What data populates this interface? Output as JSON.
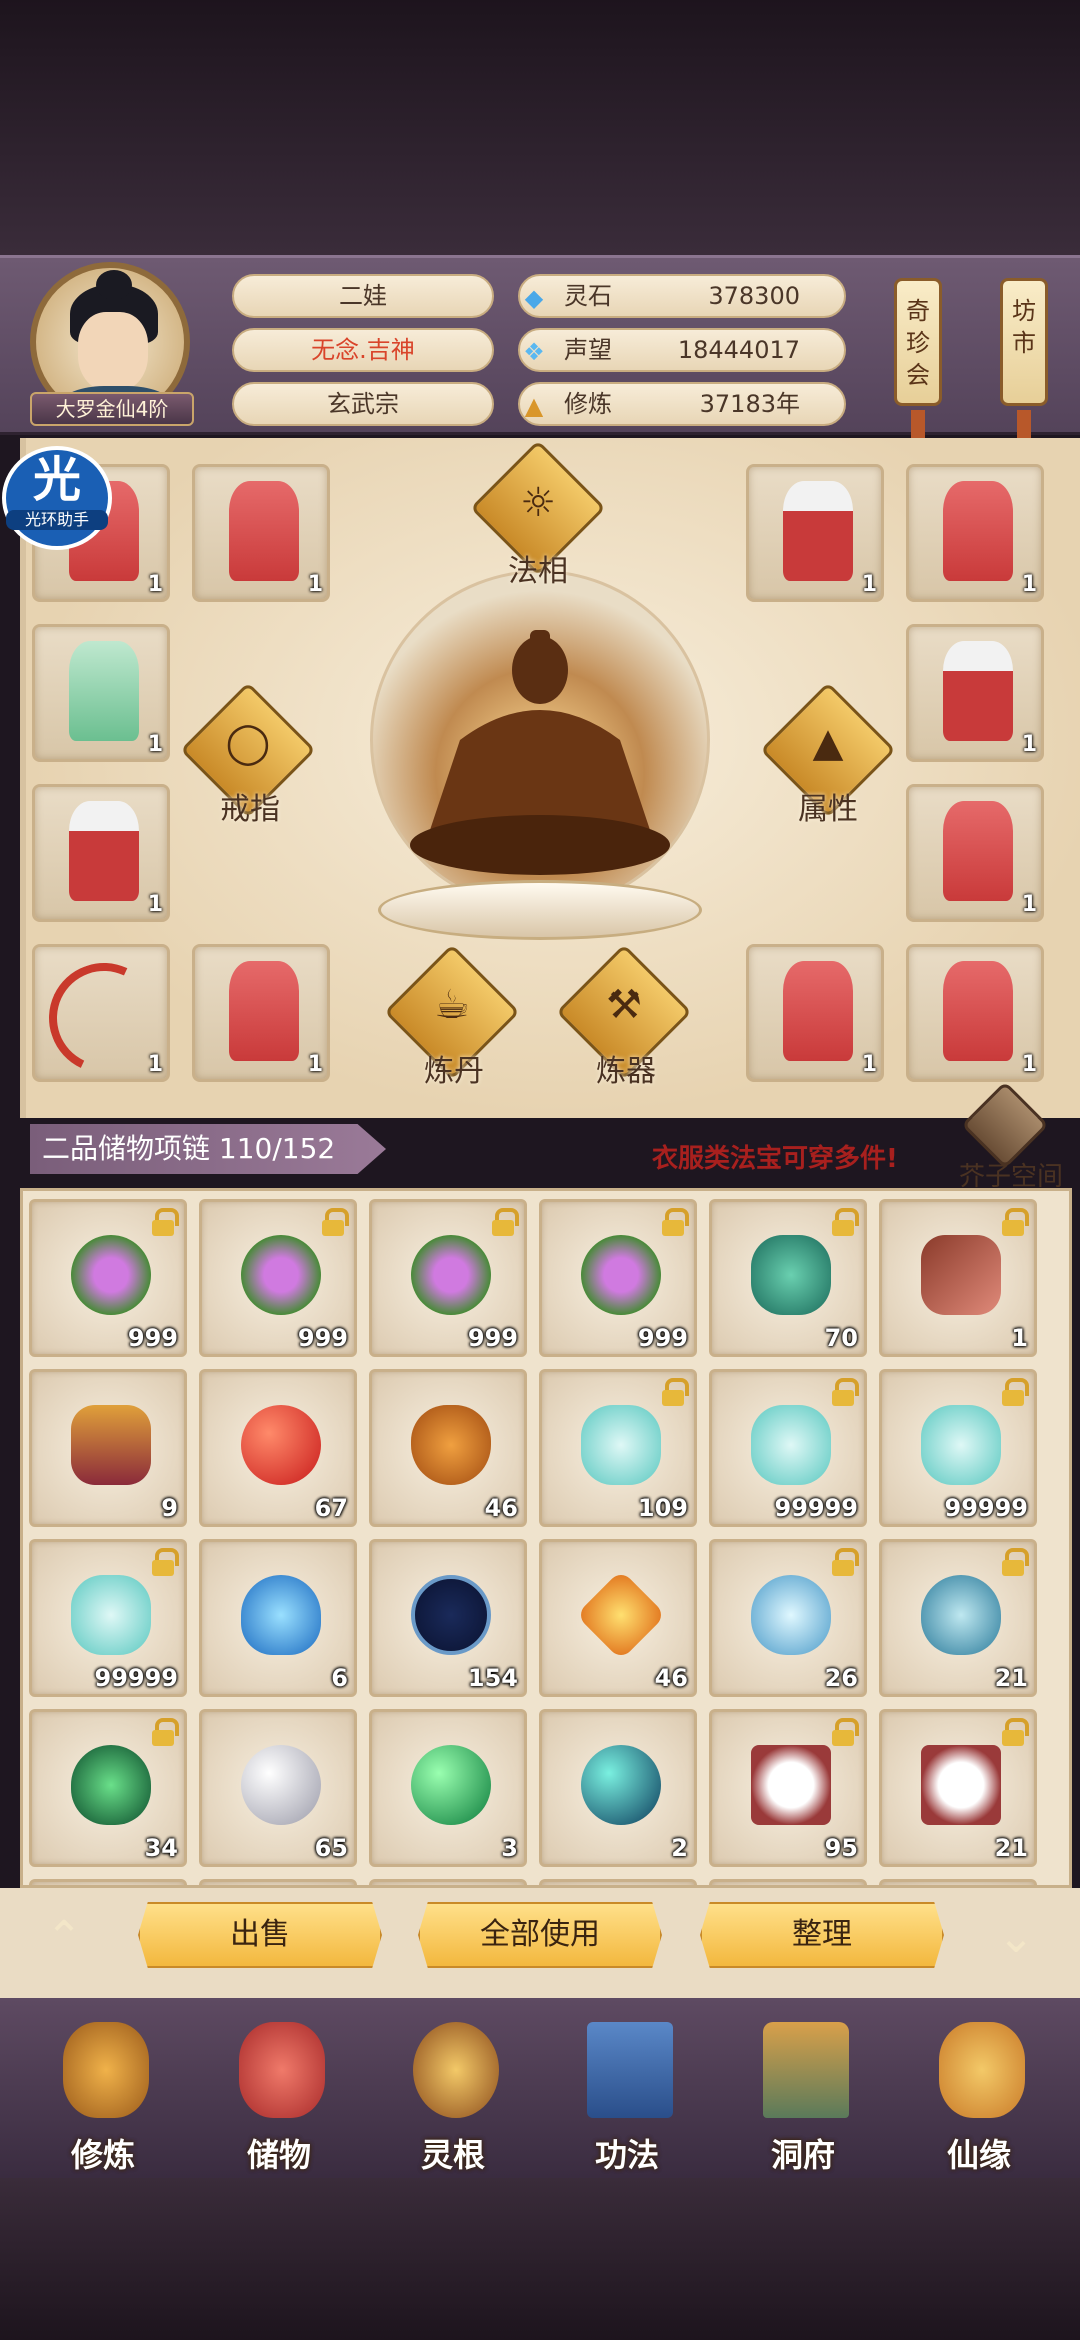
{
  "player": {
    "name": "二娃",
    "title": "无念.吉神",
    "sect": "玄武宗",
    "rank": "大罗金仙4阶"
  },
  "resources": [
    {
      "label": "灵石",
      "value": "378300",
      "icon": "crystal-icon",
      "color": "#4aa8e8"
    },
    {
      "label": "声望",
      "value": "18444017",
      "icon": "flame-icon",
      "color": "#5ab8f0"
    },
    {
      "label": "修炼",
      "value": "37183年",
      "icon": "meditation-icon",
      "color": "#d9962a"
    }
  ],
  "side_tags": [
    {
      "label": "奇珍会"
    },
    {
      "label": "坊市"
    }
  ],
  "overlay_badge": {
    "char": "光",
    "text": "光环助手"
  },
  "equipment": {
    "functions": [
      {
        "label": "法相",
        "icon": "meditation-icon"
      },
      {
        "label": "戒指",
        "icon": "ring-icon"
      },
      {
        "label": "属性",
        "icon": "hat-icon"
      },
      {
        "label": "炼丹",
        "icon": "cauldron-icon"
      },
      {
        "label": "炼器",
        "icon": "anvil-icon"
      }
    ],
    "slots": [
      {
        "item": "red-robe",
        "qty": "1"
      },
      {
        "item": "red-robe",
        "qty": "1"
      },
      {
        "item": "white-red-robe",
        "qty": "1"
      },
      {
        "item": "red-robe",
        "qty": "1"
      },
      {
        "item": "green-robe",
        "qty": "1"
      },
      {
        "item": "white-red-robe",
        "qty": "1"
      },
      {
        "item": "white-red-robe",
        "qty": "1"
      },
      {
        "item": "red-robe",
        "qty": "1"
      },
      {
        "item": "bow",
        "qty": "1"
      },
      {
        "item": "red-robe",
        "qty": "1"
      },
      {
        "item": "red-robe",
        "qty": "1"
      },
      {
        "item": "red-robe",
        "qty": "1"
      }
    ]
  },
  "storage": {
    "tab_label": "二品储物项链 110/152",
    "notice": "衣服类法宝可穿多件!",
    "space_label": "芥子空间",
    "items": [
      {
        "icon": "purple-herb",
        "qty": "999",
        "locked": true
      },
      {
        "icon": "purple-herb",
        "qty": "999",
        "locked": true
      },
      {
        "icon": "purple-herb",
        "qty": "999",
        "locked": true
      },
      {
        "icon": "purple-herb",
        "qty": "999",
        "locked": true
      },
      {
        "icon": "teal-plant",
        "qty": "70",
        "locked": true
      },
      {
        "icon": "red-branch",
        "qty": "1",
        "locked": true
      },
      {
        "icon": "scroll-drum",
        "qty": "9",
        "locked": false
      },
      {
        "icon": "red-orb",
        "qty": "67",
        "locked": false
      },
      {
        "icon": "gourd",
        "qty": "46",
        "locked": false
      },
      {
        "icon": "potion-bottle",
        "qty": "109",
        "locked": true
      },
      {
        "icon": "potion-bottle",
        "qty": "99999",
        "locked": true
      },
      {
        "icon": "potion-bottle",
        "qty": "99999",
        "locked": true
      },
      {
        "icon": "potion-bottle",
        "qty": "99999",
        "locked": true
      },
      {
        "icon": "spirit-bowl",
        "qty": "6",
        "locked": false
      },
      {
        "icon": "star-disc",
        "qty": "154",
        "locked": false
      },
      {
        "icon": "orange-gem",
        "qty": "46",
        "locked": false
      },
      {
        "icon": "ice-egg",
        "qty": "26",
        "locked": true
      },
      {
        "icon": "crystal-egg",
        "qty": "21",
        "locked": true
      },
      {
        "icon": "skull-egg",
        "qty": "34",
        "locked": true
      },
      {
        "icon": "silver-orb",
        "qty": "65",
        "locked": false
      },
      {
        "icon": "green-orb",
        "qty": "3",
        "locked": false
      },
      {
        "icon": "teal-orb",
        "qty": "2",
        "locked": false
      },
      {
        "icon": "rice-tray",
        "qty": "95",
        "locked": true
      },
      {
        "icon": "rice-tray",
        "qty": "21",
        "locked": true
      }
    ]
  },
  "actions": {
    "sell": "出售",
    "use_all": "全部使用",
    "sort": "整理"
  },
  "nav": [
    {
      "label": "修炼",
      "icon": "cultivate-icon"
    },
    {
      "label": "储物",
      "icon": "bag-icon"
    },
    {
      "label": "灵根",
      "icon": "spirit-root-icon"
    },
    {
      "label": "功法",
      "icon": "book-icon"
    },
    {
      "label": "洞府",
      "icon": "cave-icon"
    },
    {
      "label": "仙缘",
      "icon": "gourd-icon"
    }
  ],
  "colors": {
    "accent": "#c9392b",
    "gold": "#f3b83e",
    "panel": "#efe3cd"
  }
}
